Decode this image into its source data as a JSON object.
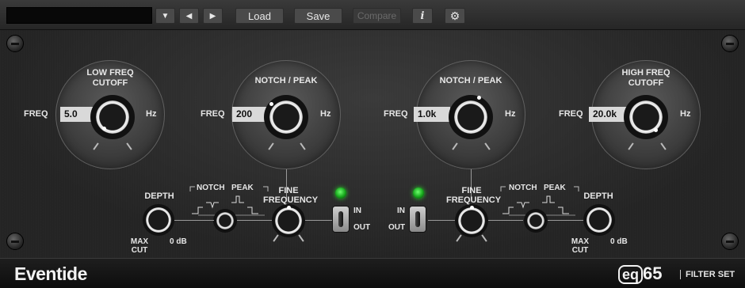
{
  "toolbar": {
    "preset_name": "",
    "load_label": "Load",
    "save_label": "Save",
    "compare_label": "Compare",
    "info_label": "i"
  },
  "left": {
    "low_cutoff": {
      "title_line1": "LOW FREQ",
      "title_line2": "CUTOFF",
      "freq_label": "FREQ",
      "value": "5.0",
      "unit": "Hz"
    },
    "notch_peak": {
      "title": "NOTCH / PEAK",
      "freq_label": "FREQ",
      "value": "200",
      "unit": "Hz"
    },
    "depth": {
      "title": "DEPTH",
      "max_cut_line1": "MAX",
      "max_cut_line2": "CUT",
      "zero_db": "0 dB"
    },
    "mode": {
      "notch": "NOTCH",
      "peak": "PEAK"
    },
    "fine_frequency": {
      "line1": "FINE",
      "line2": "FREQUENCY"
    },
    "switch": {
      "in": "IN",
      "out": "OUT"
    }
  },
  "right": {
    "notch_peak": {
      "title": "NOTCH / PEAK",
      "freq_label": "FREQ",
      "value": "1.0k",
      "unit": "Hz"
    },
    "high_cutoff": {
      "title_line1": "HIGH FREQ",
      "title_line2": "CUTOFF",
      "freq_label": "FREQ",
      "value": "20.0k",
      "unit": "Hz"
    },
    "depth": {
      "title": "DEPTH",
      "max_cut_line1": "MAX",
      "max_cut_line2": "CUT",
      "zero_db": "0 dB"
    },
    "mode": {
      "notch": "NOTCH",
      "peak": "PEAK"
    },
    "fine_frequency": {
      "line1": "FINE",
      "line2": "FREQUENCY"
    },
    "switch": {
      "in": "IN",
      "out": "OUT"
    }
  },
  "footer": {
    "brand": "Eventide",
    "product_eq": "eq",
    "product_num": "65",
    "subtitle": "FILTER SET"
  },
  "colors": {
    "led_on": "#22c322",
    "value_box": "#d9d9d9"
  },
  "icons": [
    "chevron-down-icon",
    "chevron-left-icon",
    "chevron-right-icon",
    "gear-icon",
    "info-icon"
  ]
}
